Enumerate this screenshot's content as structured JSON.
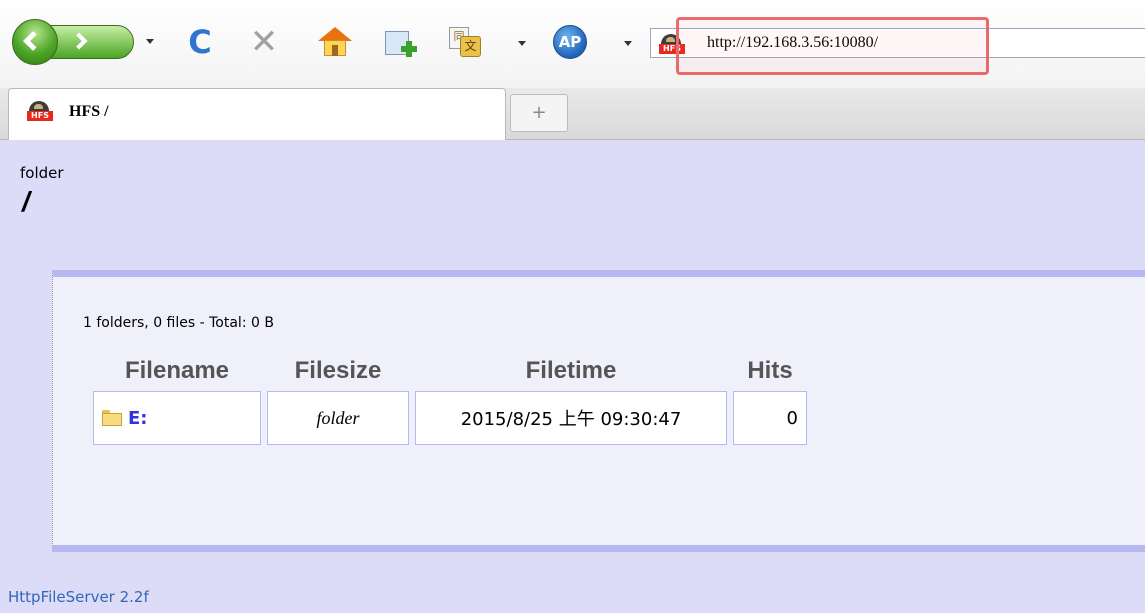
{
  "browser": {
    "url": "http://192.168.3.56:10080/",
    "tab_title": "HFS /",
    "new_tab_label": "+",
    "favicon_label": "HFS",
    "ap_icon_label": "AP",
    "translate_glyph_a": "同",
    "translate_glyph_b": "文",
    "reload_glyph": "C",
    "stop_glyph": "✕"
  },
  "page": {
    "breadcrumb_label": "folder",
    "path": "/",
    "summary": "1 folders, 0 files - Total: 0 B",
    "columns": [
      "Filename",
      "Filesize",
      "Filetime",
      "Hits"
    ],
    "rows": [
      {
        "name": "E:",
        "size": "folder",
        "time": "2015/8/25 上午 09:30:47",
        "hits": "0"
      }
    ],
    "footer": "HttpFileServer 2.2f"
  },
  "colors": {
    "page_bg": "#dcdcf9",
    "panel_border": "#b7b7f1",
    "link": "#3333dd",
    "highlight": "#ea6a6a"
  }
}
